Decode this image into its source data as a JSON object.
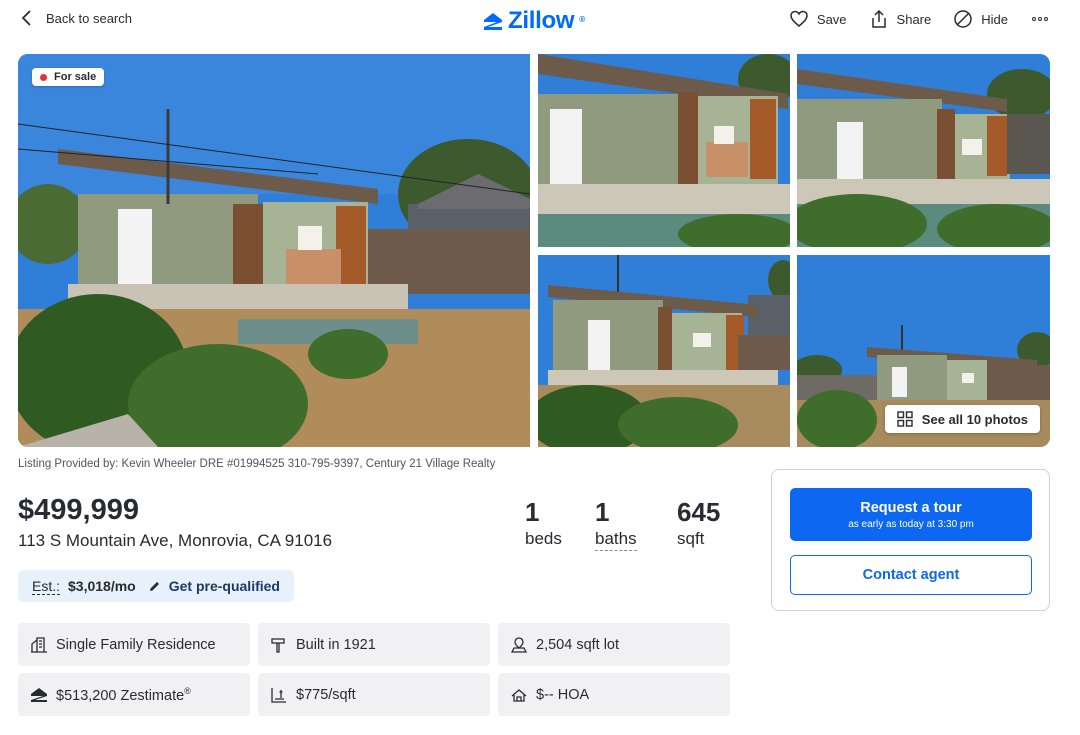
{
  "header": {
    "back_label": "Back to search",
    "logo_text": "Zillow",
    "logo_mark": "®",
    "actions": [
      {
        "label": "Save",
        "icon": "heart-icon"
      },
      {
        "label": "Share",
        "icon": "share-icon"
      },
      {
        "label": "Hide",
        "icon": "hide-icon"
      }
    ],
    "more_icon": "more-icon"
  },
  "gallery": {
    "badge": "For sale",
    "badge_color": "#d9363e",
    "see_all": "See all 10 photos"
  },
  "listing_provided": "Listing Provided by: Kevin Wheeler DRE #01994525 310-795-9397, Century 21 Village Realty",
  "summary": {
    "price": "$499,999",
    "address": "113 S Mountain Ave, Monrovia, CA 91016",
    "beds": {
      "value": "1",
      "label": "beds"
    },
    "baths": {
      "value": "1",
      "label": "baths"
    },
    "sqft": {
      "value": "645",
      "label": "sqft"
    }
  },
  "estimate": {
    "label": "Est.:",
    "value": "$3,018/mo",
    "prequal": "Get pre-qualified"
  },
  "facts": [
    {
      "label": "Single Family Residence",
      "icon": "home-type-icon"
    },
    {
      "label": "Built in 1921",
      "icon": "hammer-icon"
    },
    {
      "label": "2,504 sqft lot",
      "icon": "lot-icon"
    },
    {
      "label": "$513,200 Zestimate",
      "sup": "®",
      "icon": "zestimate-icon"
    },
    {
      "label": "$775/sqft",
      "icon": "price-per-sqft-icon"
    },
    {
      "label": "$-- HOA",
      "icon": "hoa-icon"
    }
  ],
  "tour_card": {
    "tour_title": "Request a tour",
    "tour_sub": "as early as today at 3:30 pm",
    "contact": "Contact agent"
  },
  "colors": {
    "brand_blue": "#006aff",
    "button_blue": "#0d67f0",
    "estimate_bg": "#e6f1fc",
    "fact_bg": "#f1f1f4"
  }
}
